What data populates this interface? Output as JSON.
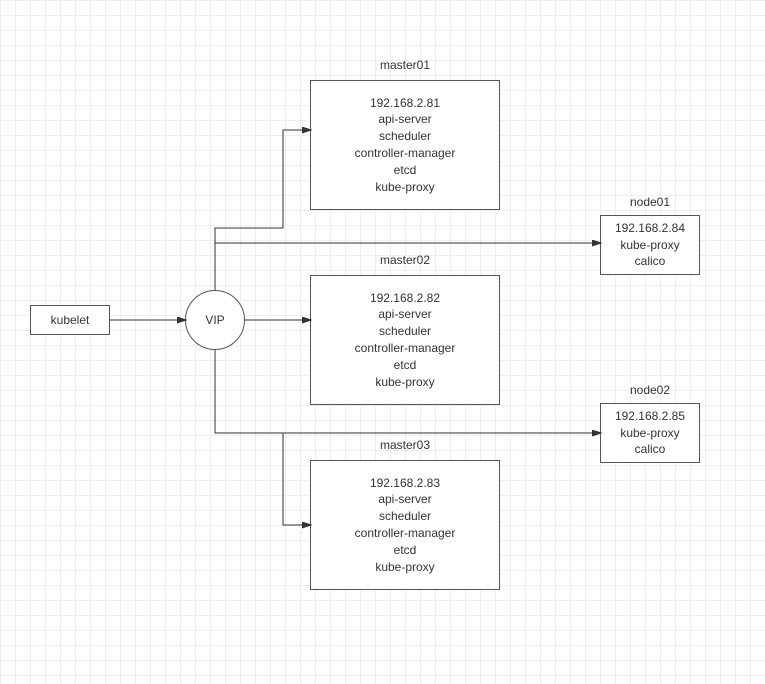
{
  "kubelet": {
    "label": "kubelet"
  },
  "vip": {
    "label": "VIP"
  },
  "masters": [
    {
      "title": "master01",
      "ip": "192.168.2.81",
      "lines": [
        "api-server",
        "scheduler",
        "controller-manager",
        "etcd",
        "kube-proxy"
      ]
    },
    {
      "title": "master02",
      "ip": "192.168.2.82",
      "lines": [
        "api-server",
        "scheduler",
        "controller-manager",
        "etcd",
        "kube-proxy"
      ]
    },
    {
      "title": "master03",
      "ip": "192.168.2.83",
      "lines": [
        "api-server",
        "scheduler",
        "controller-manager",
        "etcd",
        "kube-proxy"
      ]
    }
  ],
  "nodes": [
    {
      "title": "node01",
      "ip": "192.168.2.84",
      "lines": [
        "kube-proxy",
        "calico"
      ]
    },
    {
      "title": "node02",
      "ip": "192.168.2.85",
      "lines": [
        "kube-proxy",
        "calico"
      ]
    }
  ]
}
